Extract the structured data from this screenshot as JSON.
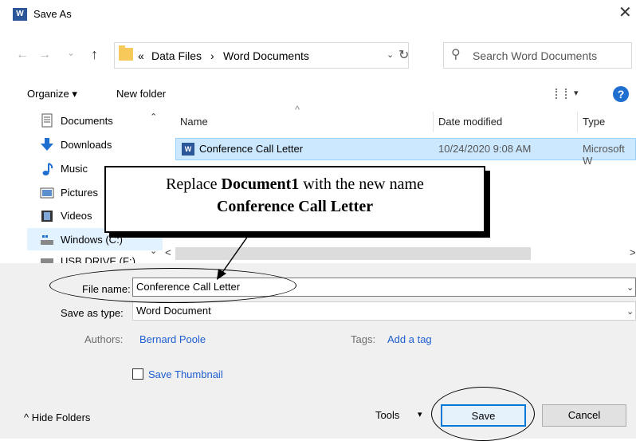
{
  "window": {
    "title": "Save As",
    "app_icon": "W",
    "close_glyph": "✕"
  },
  "address_bar": {
    "back_glyph": "←",
    "forward_glyph": "→",
    "recent_glyph": "⌄",
    "up_glyph": "↑",
    "overflow_glyph": "«",
    "crumbs": [
      "Data Files",
      "Word Documents"
    ],
    "separator": "›",
    "dropdown_glyph": "⌄",
    "refresh_glyph": "↻",
    "search_glyph": "⚲",
    "search_placeholder": "Search Word Documents"
  },
  "toolbar": {
    "organize_label": "Organize ▾",
    "new_folder_label": "New folder",
    "view_dropdown_glyph": "▾",
    "help_label": "?"
  },
  "nav_pane": {
    "items": [
      {
        "label": "Documents",
        "icon": "documents-icon"
      },
      {
        "label": "Downloads",
        "icon": "downloads-icon"
      },
      {
        "label": "Music",
        "icon": "music-icon"
      },
      {
        "label": "Pictures",
        "icon": "pictures-icon"
      },
      {
        "label": "Videos",
        "icon": "videos-icon"
      },
      {
        "label": "Windows (C:)",
        "icon": "drive-icon"
      },
      {
        "label": "USB DRIVE (F:)",
        "icon": "usb-drive-icon"
      }
    ],
    "scroll_up": "⌃",
    "scroll_down": "⌄"
  },
  "file_list": {
    "columns": [
      "Name",
      "Date modified",
      "Type"
    ],
    "sort_indicator": "^",
    "rows": [
      {
        "name": "Conference Call Letter",
        "date": "10/24/2020 9:08 AM",
        "type": "Microsoft W",
        "icon_text": "W"
      }
    ],
    "scroll_left": "<",
    "scroll_right": ">"
  },
  "form": {
    "file_name_label": "File name:",
    "file_name_value": "Conference Call Letter",
    "save_as_type_label": "Save as type:",
    "save_as_type_value": "Word Document",
    "authors_label": "Authors:",
    "authors_value": "Bernard Poole",
    "tags_label": "Tags:",
    "tags_value": "Add a tag",
    "thumbnail_label": "Save Thumbnail",
    "dropdown_glyph": "⌄"
  },
  "footer": {
    "hide_folders_label": "^  Hide Folders",
    "tools_label": "Tools",
    "tools_dropdown": "▾",
    "save_label": "Save",
    "cancel_label": "Cancel"
  },
  "annotation": {
    "line1_prefix": "Replace ",
    "line1_bold": "Document1",
    "line1_suffix": " with the new name",
    "line2_bold": "Conference Call Letter"
  },
  "colors": {
    "selection": "#cce8ff",
    "accent": "#0078d7",
    "link": "#1e5ed1",
    "word_blue": "#2b579a"
  }
}
